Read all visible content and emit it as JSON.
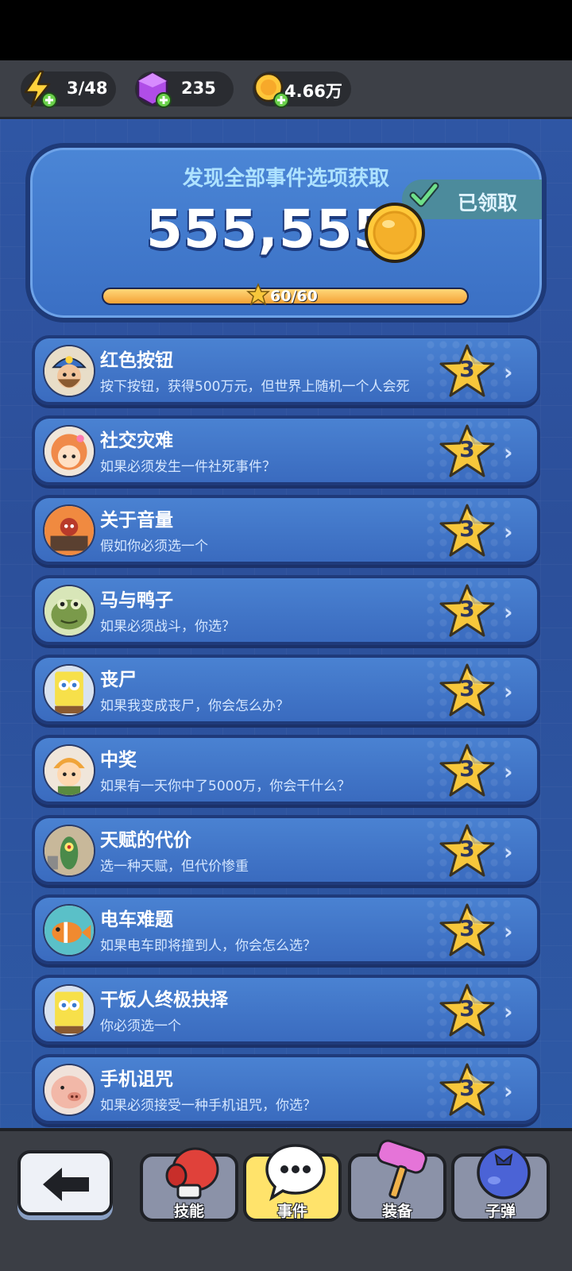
{
  "resources": {
    "energy": "3/48",
    "gems": "235",
    "coins": "4.66万"
  },
  "reward": {
    "title": "发现全部事件选项获取",
    "amount": "555,555",
    "claimed_label": "已领取",
    "progress_text": "60/60",
    "progress_fraction": 1.0
  },
  "events": [
    {
      "title": "红色按钮",
      "desc": "按下按钮，获得500万元，但世界上随机一个人会死",
      "stars": "3",
      "avatar": "miner-avatar"
    },
    {
      "title": "社交灾难",
      "desc": "如果必须发生一件社死事件？",
      "stars": "3",
      "avatar": "girl-avatar"
    },
    {
      "title": "关于音量",
      "desc": "假如你必须选一个",
      "stars": "3",
      "avatar": "skull-avatar"
    },
    {
      "title": "马与鸭子",
      "desc": "如果必须战斗，你选？",
      "stars": "3",
      "avatar": "frog-avatar"
    },
    {
      "title": "丧尸",
      "desc": "如果我变成丧尸，你会怎么办？",
      "stars": "3",
      "avatar": "sponge-avatar"
    },
    {
      "title": "中奖",
      "desc": "如果有一天你中了5000万，你会干什么？",
      "stars": "3",
      "avatar": "boy-avatar"
    },
    {
      "title": "天赋的代价",
      "desc": "选一种天赋，但代价惨重",
      "stars": "3",
      "avatar": "plankton-avatar"
    },
    {
      "title": "电车难题",
      "desc": "如果电车即将撞到人，你会怎么选？",
      "stars": "3",
      "avatar": "fish-avatar"
    },
    {
      "title": "干饭人终极抉择",
      "desc": "你必须选一个",
      "stars": "3",
      "avatar": "sponge-avatar"
    },
    {
      "title": "手机诅咒",
      "desc": "如果必须接受一种手机诅咒，你选？",
      "stars": "3",
      "avatar": "pig-avatar"
    }
  ],
  "nav": {
    "tabs": [
      {
        "label": "技能",
        "icon": "boxing-glove-icon",
        "active": false
      },
      {
        "label": "事件",
        "icon": "chat-bubble-icon",
        "active": true
      },
      {
        "label": "装备",
        "icon": "hammer-icon",
        "active": false
      },
      {
        "label": "子弹",
        "icon": "blueberry-icon",
        "active": false
      }
    ]
  },
  "colors": {
    "background": "#2f56a4",
    "card": "#4a82d2",
    "star": "#f7c73b",
    "active_tab": "#ffe36b"
  }
}
